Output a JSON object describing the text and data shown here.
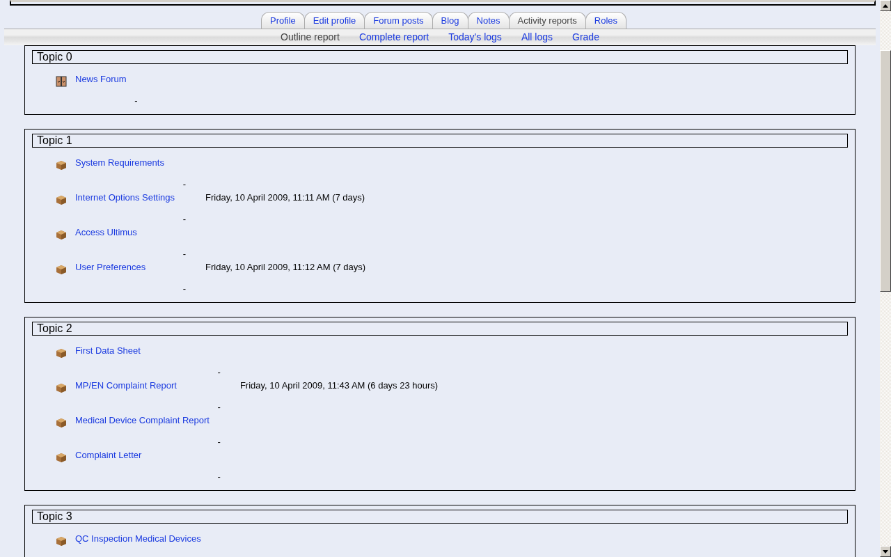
{
  "tabs": [
    {
      "label": "Profile",
      "selected": false
    },
    {
      "label": "Edit profile",
      "selected": false
    },
    {
      "label": "Forum posts",
      "selected": false
    },
    {
      "label": "Blog",
      "selected": false
    },
    {
      "label": "Notes",
      "selected": false
    },
    {
      "label": "Activity reports",
      "selected": true
    },
    {
      "label": "Roles",
      "selected": false
    }
  ],
  "subtabs": [
    {
      "label": "Outline report",
      "selected": true
    },
    {
      "label": "Complete report",
      "selected": false
    },
    {
      "label": "Today's logs",
      "selected": false
    },
    {
      "label": "All logs",
      "selected": false
    },
    {
      "label": "Grade",
      "selected": false
    }
  ],
  "sections": [
    {
      "title": "Topic 0",
      "items": [
        {
          "kind": "forum",
          "title": "News Forum",
          "views": "-"
        }
      ]
    },
    {
      "title": "Topic 1",
      "items": [
        {
          "kind": "resource",
          "title": "System Requirements",
          "views": "-"
        },
        {
          "kind": "resource",
          "title": "Internet Options Settings",
          "views": "-",
          "last_access": "Friday, 10 April 2009, 11:11 AM (7 days)"
        },
        {
          "kind": "resource",
          "title": "Access Ultimus",
          "views": "-"
        },
        {
          "kind": "resource",
          "title": "User Preferences",
          "views": "-",
          "last_access": "Friday, 10 April 2009, 11:12 AM (7 days)"
        }
      ]
    },
    {
      "title": "Topic 2",
      "items": [
        {
          "kind": "resource",
          "title": "First Data Sheet",
          "views": "-"
        },
        {
          "kind": "resource",
          "title": "MP/EN Complaint Report",
          "views": "-",
          "last_access": "Friday, 10 April 2009, 11:43 AM (6 days 23 hours)"
        },
        {
          "kind": "resource",
          "title": "Medical Device Complaint Report",
          "views": "-"
        },
        {
          "kind": "resource",
          "title": "Complaint Letter",
          "views": "-"
        }
      ]
    },
    {
      "title": "Topic 3",
      "items": [
        {
          "kind": "resource",
          "title": "QC Inspection Medical Devices"
        }
      ]
    }
  ]
}
